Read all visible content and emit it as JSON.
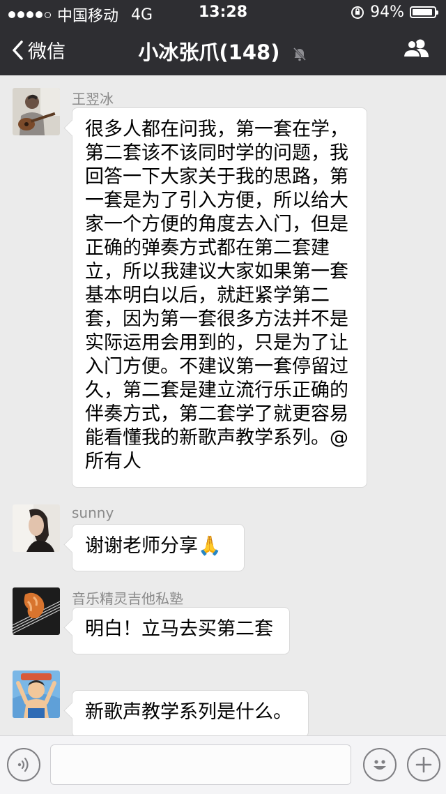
{
  "status_bar": {
    "carrier": "中国移动",
    "network": "4G",
    "time": "13:28",
    "battery": "94%",
    "battery_level": 0.94
  },
  "nav": {
    "back_label": "微信",
    "title": "小冰张爪(148)"
  },
  "messages": [
    {
      "sender": "王翌冰",
      "avatar": "guitar-player-avatar",
      "lines": [
        "很多人都在问我，第一套在学，",
        "第二套该不该同时学的问题，我",
        "回答一下大家关于我的思路，第",
        "一套是为了引入方便，所以给大",
        "家一个方便的角度去入门，但是",
        "正确的弹奏方式都在第二套建",
        "立，所以我建议大家如果第一套",
        "基本明白以后，就赶紧学第二",
        "套，因为第一套很多方法并不是",
        "实际运用会用到的，只是为了让",
        "入门方便。不建议第一套停留过",
        "久，第二套是建立流行乐正确的",
        "伴奏方式，第二套学了就更容易",
        "能看懂我的新歌声教学系列。@",
        "所有人"
      ]
    },
    {
      "sender": "sunny",
      "avatar": "woman-portrait-avatar",
      "lines": [
        "谢谢老师分享🙏"
      ]
    },
    {
      "sender": "音乐精灵吉他私塾",
      "avatar": "guitar-hand-avatar",
      "lines": [
        "明白！立马去买第二套"
      ]
    },
    {
      "sender": "",
      "avatar": "cartoon-character-avatar",
      "lines": [
        "新歌声教学系列是什么。"
      ]
    }
  ],
  "colors": {
    "header_bg": "#2e2e32",
    "chat_bg": "#ebebeb",
    "bubble_bg": "#ffffff",
    "input_bar_bg": "#f4f4f6",
    "sender_text": "#8a8a8a"
  },
  "icons": {
    "back": "chevron-left-icon",
    "mute": "bell-muted-icon",
    "group": "group-members-icon",
    "voice": "voice-icon",
    "emoji": "emoji-icon",
    "more": "plus-icon"
  }
}
